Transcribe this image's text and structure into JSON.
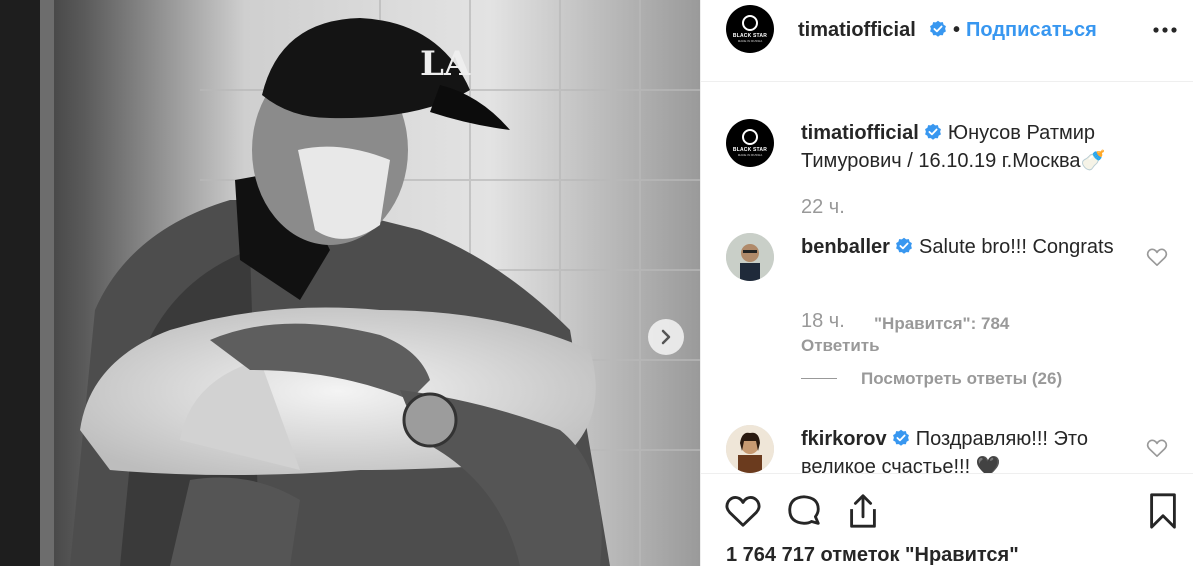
{
  "post": {
    "author": "timatiofficial",
    "follow_label": "Подписаться",
    "separator": "•",
    "avatar_logo_text": "BLACK STAR",
    "avatar_logo_subtext": "MADE IN RUSSIA",
    "caption": {
      "username": "timatiofficial",
      "text": "Юнусов Ратмир Тимурович / 16.10.19 г.Москва🍼",
      "time": "22 ч."
    },
    "comments": [
      {
        "username": "benballer",
        "text": "Salute bro!!! Congrats",
        "time": "18 ч.",
        "likes": "\"Нравится\": 784",
        "reply_label": "Ответить",
        "view_replies": "Посмотреть ответы (26)"
      },
      {
        "username": "fkirkorov",
        "text": "Поздравляю!!! Это великое счастье!!! 🖤"
      }
    ],
    "likes_total": "1 764 717 отметок \"Нравится\""
  },
  "icons": {
    "verified": "verified-badge-icon",
    "more": "more-options-icon",
    "like": "heart-icon",
    "comment": "comment-bubble-icon",
    "share": "share-icon",
    "save": "bookmark-icon",
    "next": "chevron-right-icon"
  },
  "colors": {
    "link": "#3897f0",
    "verified": "#3897f0",
    "muted": "#999999",
    "text": "#262626"
  }
}
